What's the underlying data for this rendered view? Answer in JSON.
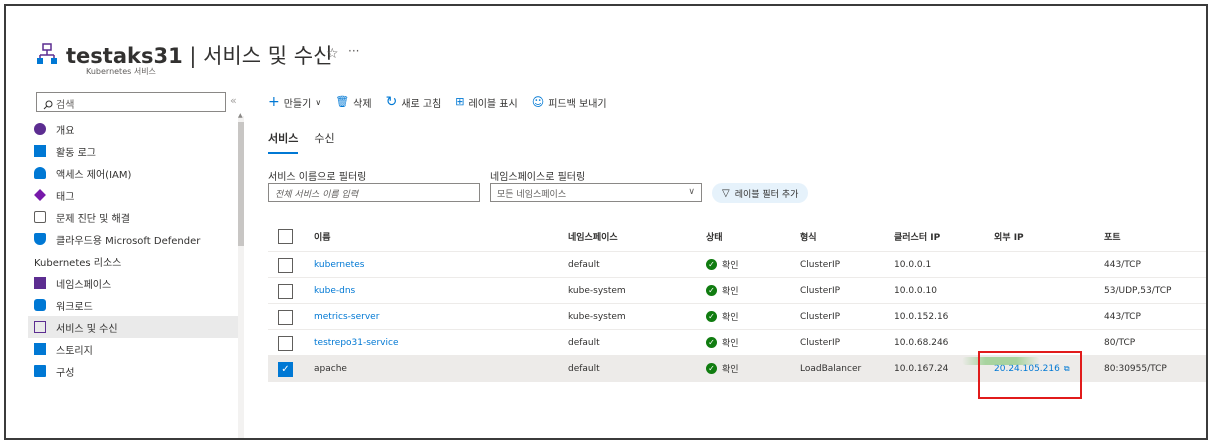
{
  "header": {
    "title_bold": "testaks31",
    "title_rest": " | 서비스 및 수신",
    "subtitle": "Kubernetes 서비스",
    "star": "☆",
    "more": "···"
  },
  "sidebar": {
    "search_placeholder": "검색",
    "collapse": "«",
    "items": [
      {
        "label": "개요",
        "icon": "overview-icon",
        "color": "#5c2d91"
      },
      {
        "label": "활동 로그",
        "icon": "activity-log-icon",
        "color": "#0078d4"
      },
      {
        "label": "액세스 제어(IAM)",
        "icon": "iam-icon",
        "color": "#0078d4"
      },
      {
        "label": "태그",
        "icon": "tag-icon",
        "color": "#7719aa"
      },
      {
        "label": "문제 진단 및 해결",
        "icon": "diagnose-icon",
        "color": "#605e5c"
      },
      {
        "label": "클라우드용 Microsoft Defender",
        "icon": "defender-icon",
        "color": "#0078d4"
      }
    ],
    "group_label": "Kubernetes 리소스",
    "group_items": [
      {
        "label": "네임스페이스",
        "icon": "namespace-icon",
        "color": "#5c2d91"
      },
      {
        "label": "워크로드",
        "icon": "workload-icon",
        "color": "#0078d4"
      },
      {
        "label": "서비스 및 수신",
        "icon": "services-icon",
        "color": "#5c2d91"
      },
      {
        "label": "스토리지",
        "icon": "storage-icon",
        "color": "#0078d4"
      },
      {
        "label": "구성",
        "icon": "config-icon",
        "color": "#0078d4"
      }
    ]
  },
  "toolbar": {
    "create": "만들기",
    "delete": "삭제",
    "refresh": "새로 고침",
    "show_labels": "레이블 표시",
    "feedback": "피드백 보내기"
  },
  "tabs": [
    "서비스",
    "수신"
  ],
  "filters": {
    "name_label": "서비스 이름으로 필터링",
    "name_placeholder": "전체 서비스 이름 입력",
    "ns_label": "네임스페이스로 필터링",
    "ns_value": "모든 네임스페이스",
    "add_label_filter": "레이블 필터 추가"
  },
  "table": {
    "columns": [
      "이름",
      "네임스페이스",
      "상태",
      "형식",
      "클러스터 IP",
      "외부 IP",
      "포트"
    ],
    "rows": [
      {
        "name": "kubernetes",
        "namespace": "default",
        "status": "확인",
        "type": "ClusterIP",
        "cluster_ip": "10.0.0.1",
        "external_ip": "",
        "ports": "443/TCP",
        "selected": false
      },
      {
        "name": "kube-dns",
        "namespace": "kube-system",
        "status": "확인",
        "type": "ClusterIP",
        "cluster_ip": "10.0.0.10",
        "external_ip": "",
        "ports": "53/UDP,53/TCP",
        "selected": false
      },
      {
        "name": "metrics-server",
        "namespace": "kube-system",
        "status": "확인",
        "type": "ClusterIP",
        "cluster_ip": "10.0.152.16",
        "external_ip": "",
        "ports": "443/TCP",
        "selected": false
      },
      {
        "name": "testrepo31-service",
        "namespace": "default",
        "status": "확인",
        "type": "ClusterIP",
        "cluster_ip": "10.0.68.246",
        "external_ip": "",
        "ports": "80/TCP",
        "selected": false
      },
      {
        "name": "apache",
        "namespace": "default",
        "status": "확인",
        "type": "LoadBalancer",
        "cluster_ip": "10.0.167.24",
        "external_ip": "20.24.105.216",
        "ports": "80:30955/TCP",
        "selected": true
      }
    ]
  },
  "colors": {
    "accent": "#0078d4",
    "highlight": "#e11b1b",
    "ok": "#107c10"
  }
}
